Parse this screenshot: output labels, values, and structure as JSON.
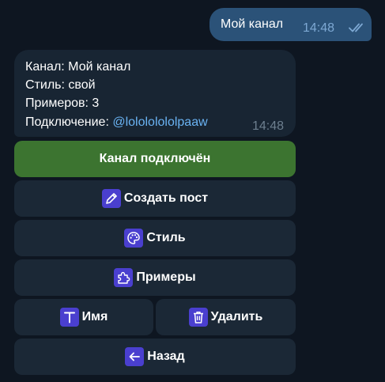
{
  "outgoing": {
    "text": "Мой канал",
    "time": "14:48",
    "status_icon": "double-check-icon"
  },
  "incoming": {
    "line1": "Канал: Мой канал",
    "line2": "Стиль: свой",
    "line3": "Примеров: 3",
    "line4_label": "Подключение: ",
    "line4_link": "@lolololololpaaw",
    "time": "14:48"
  },
  "keyboard": {
    "connected": "Канал подключён",
    "create_post": "Создать пост",
    "style": "Стиль",
    "examples": "Примеры",
    "name": "Имя",
    "delete": "Удалить",
    "back": "Назад"
  },
  "icons": {
    "create_post": "pencil-icon",
    "style": "palette-icon",
    "examples": "puzzle-icon",
    "name": "text-t-icon",
    "delete": "trash-icon",
    "back": "arrow-left-icon"
  },
  "colors": {
    "background": "#0e1621",
    "outgoing_bubble": "#2b5278",
    "incoming_bubble": "#182533",
    "button": "#1b2836",
    "button_success": "#3c7430",
    "icon_badge": "#4a3fcf",
    "link": "#6ab3f3"
  }
}
